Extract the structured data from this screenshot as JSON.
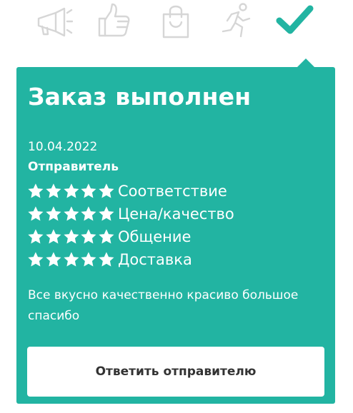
{
  "progress_steps": [
    {
      "icon": "megaphone-icon",
      "state": "inactive"
    },
    {
      "icon": "thumbs-up-icon",
      "state": "inactive"
    },
    {
      "icon": "shopping-bag-icon",
      "state": "inactive"
    },
    {
      "icon": "running-person-icon",
      "state": "inactive"
    },
    {
      "icon": "checkmark-icon",
      "state": "active"
    }
  ],
  "colors": {
    "accent": "#22b4a2",
    "inactive_icon": "#d6d6d6",
    "text_on_accent": "#ffffff",
    "button_text": "#333333"
  },
  "card": {
    "title": "Заказ выполнен",
    "date": "10.04.2022",
    "sender_label": "Отправитель",
    "ratings": [
      {
        "label": "Соответствие",
        "stars": 5,
        "max": 5
      },
      {
        "label": "Цена/качество",
        "stars": 5,
        "max": 5
      },
      {
        "label": "Общение",
        "stars": 5,
        "max": 5
      },
      {
        "label": "Доставка",
        "stars": 5,
        "max": 5
      }
    ],
    "comment": "Все вкусно качественно красиво большое спасибо",
    "reply_button": "Ответить отправителю"
  }
}
